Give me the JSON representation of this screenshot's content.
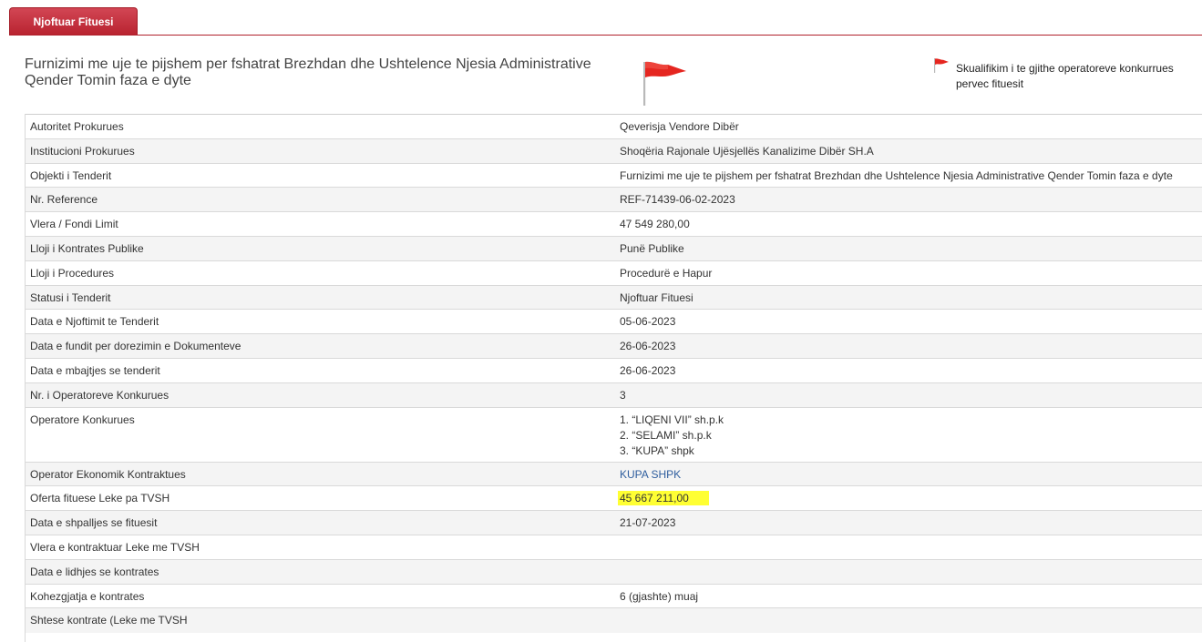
{
  "tabs": [
    {
      "label": "Njoftuar Fituesi",
      "active": true
    }
  ],
  "header": {
    "title": "Furnizimi me uje te pijshem per fshatrat Brezhdan dhe Ushtelence Njesia Administrative Qender Tomin faza e dyte",
    "note": "Skualifikim i te gjithe operatoreve konkurrues pervec fituesit",
    "flag_icon": "red-flag-icon",
    "flag_color": "#e52620"
  },
  "details": {
    "rows": [
      {
        "label": "Autoritet Prokurues",
        "value": "Qeverisja Vendore Dibër"
      },
      {
        "label": "Institucioni Prokurues",
        "value": "Shoqëria Rajonale Ujësjellës Kanalizime Dibër SH.A"
      },
      {
        "label": "Objekti i Tenderit",
        "value": "Furnizimi me uje te pijshem per fshatrat Brezhdan dhe Ushtelence Njesia Administrative Qender Tomin faza e dyte"
      },
      {
        "label": "Nr. Reference",
        "value": "REF-71439-06-02-2023"
      },
      {
        "label": "Vlera / Fondi Limit",
        "value": "47 549 280,00"
      },
      {
        "label": "Lloji i Kontrates Publike",
        "value": "Punë Publike"
      },
      {
        "label": "Lloji i Procedures",
        "value": "Procedurë e Hapur"
      },
      {
        "label": "Statusi i Tenderit",
        "value": "Njoftuar Fituesi"
      },
      {
        "label": "Data e Njoftimit te Tenderit",
        "value": "05-06-2023"
      },
      {
        "label": "Data e fundit per dorezimin e Dokumenteve",
        "value": "26-06-2023"
      },
      {
        "label": "Data e mbajtjes se tenderit",
        "value": "26-06-2023"
      },
      {
        "label": "Nr. i Operatoreve Konkurues",
        "value": "3"
      }
    ],
    "operators_label": "Operatore Konkurues",
    "operators": [
      "1. “LIQENI VII” sh.p.k",
      "2. “SELAMI” sh.p.k",
      "3. “KUPA” shpk"
    ],
    "contractor_label": "Operator Ekonomik Kontraktues",
    "contractor_value": "KUPA SHPK",
    "winning_offer_label": "Oferta fituese Leke pa TVSH",
    "winning_offer_value": "45 667 211,00",
    "highlight_color": "#ffff33",
    "rows_after": [
      {
        "label": "Data e shpalljes se fituesit",
        "value": "21-07-2023"
      },
      {
        "label": "Vlera e kontraktuar Leke me TVSH",
        "value": ""
      },
      {
        "label": "Data e lidhjes se kontrates",
        "value": ""
      },
      {
        "label": "Kohezgjatja e kontrates",
        "value": "6 (gjashte) muaj"
      },
      {
        "label": "Shtese kontrate (Leke me TVSH",
        "value": ""
      }
    ]
  }
}
